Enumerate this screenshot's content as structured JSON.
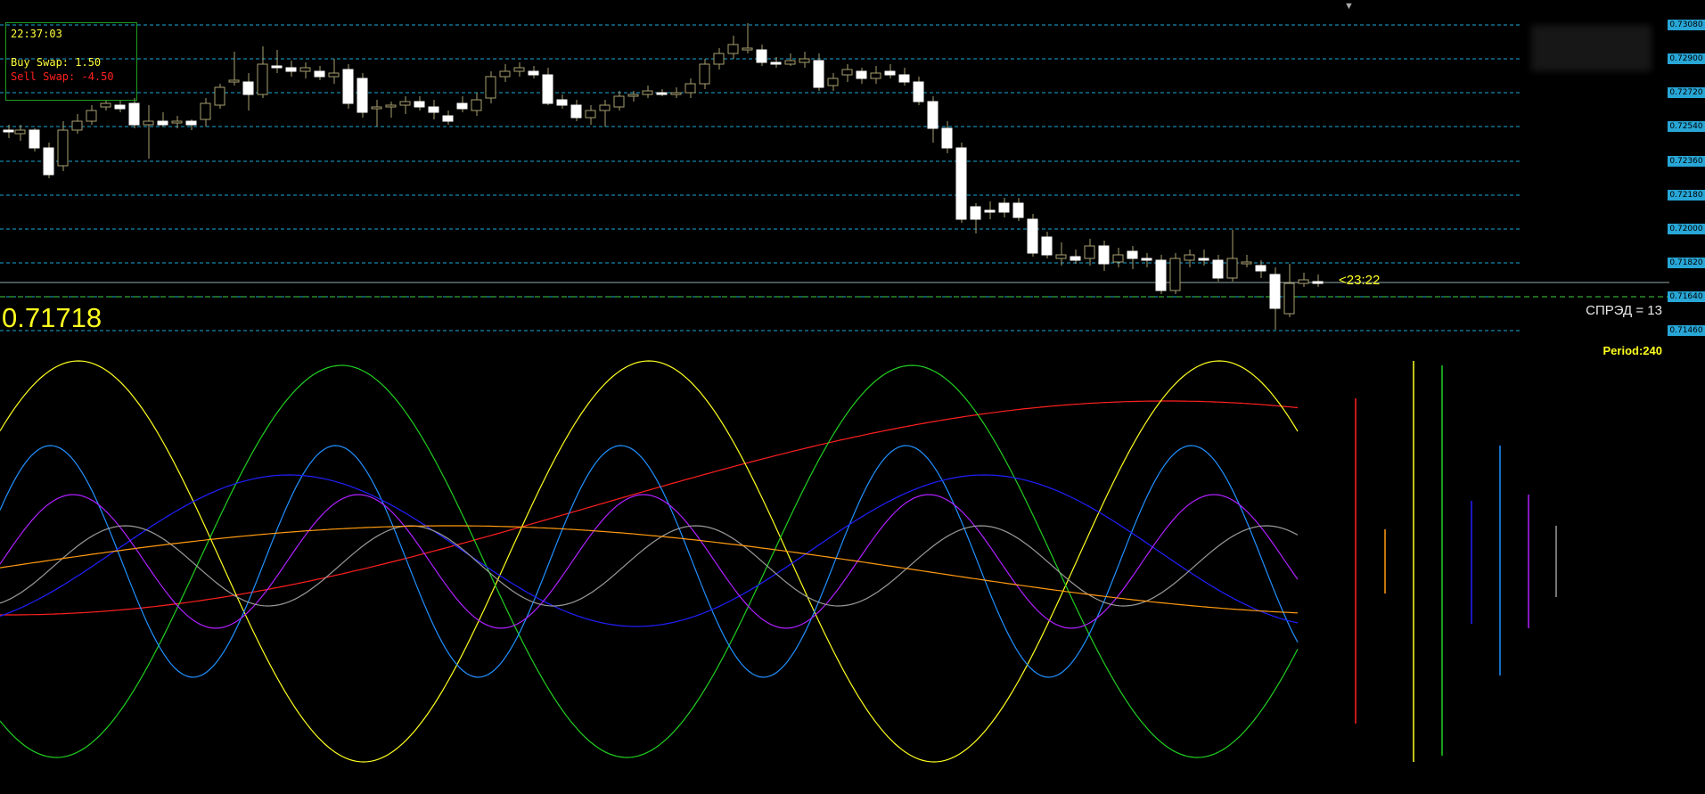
{
  "info": {
    "time": "22:37:03",
    "buy_swap": "Buy Swap: 1.50",
    "sell_swap": "Sell Swap: -4.50"
  },
  "current_price": "0.71718",
  "bar_timer": "<23:22",
  "spread": "СПРЭД = 13",
  "period": "Period:240",
  "price_axis": [
    "0.73080",
    "0.72900",
    "0.72720",
    "0.72540",
    "0.72360",
    "0.72180",
    "0.72000",
    "0.71820",
    "0.71640",
    "0.71460"
  ],
  "colors": {
    "grid": "#1aa7d8",
    "candle": "#ffffff",
    "accent": "#ffff20",
    "red": "#ff2020",
    "green": "#20d020",
    "yellow": "#ffff20",
    "blue": "#2090ff",
    "darkblue": "#2020ff",
    "purple": "#b020ff",
    "gray": "#9a9a9a",
    "orange": "#ff9a10"
  }
}
